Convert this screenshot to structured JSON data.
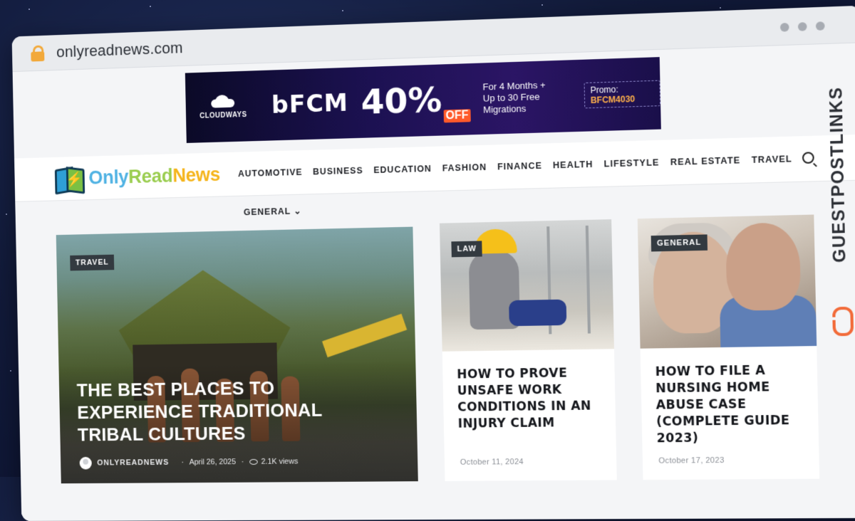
{
  "browser": {
    "url": "onlyreadnews.com"
  },
  "ad": {
    "brand": "CLOUDWAYS",
    "headline": "bFCM",
    "discount": "40%",
    "off_label": "OFF",
    "line1": "For 4 Months +",
    "line2": "Up to 30 Free Migrations",
    "promo_label": "Promo:",
    "promo_code": "BFCM4030"
  },
  "site": {
    "logo": {
      "part1": "Only",
      "part2": "Read",
      "part3": "News"
    },
    "nav": [
      "AUTOMOTIVE",
      "BUSINESS",
      "EDUCATION",
      "FASHION",
      "FINANCE",
      "HEALTH",
      "LIFESTYLE",
      "REAL ESTATE",
      "TRAVEL"
    ],
    "subnav": "GENERAL ⌄"
  },
  "featured": {
    "tag": "TRAVEL",
    "title": "THE BEST PLACES TO EXPERIENCE TRADITIONAL TRIBAL CULTURES",
    "author": "ONLYREADNEWS",
    "date": "April 26, 2025",
    "views": "2.1K views"
  },
  "cards": [
    {
      "tag": "LAW",
      "title": "HOW TO PROVE UNSAFE WORK CONDITIONS IN AN INJURY CLAIM",
      "date": "October 11, 2024"
    },
    {
      "tag": "GENERAL",
      "title": "HOW TO FILE A NURSING HOME ABUSE CASE (COMPLETE GUIDE 2023)",
      "date": "October 17, 2023"
    }
  ],
  "watermark": "GUESTPOSTLINKS",
  "colors": {
    "accent_orange": "#f26b3a",
    "lock": "#f2a93b",
    "ad_bg": "#1c1152"
  }
}
